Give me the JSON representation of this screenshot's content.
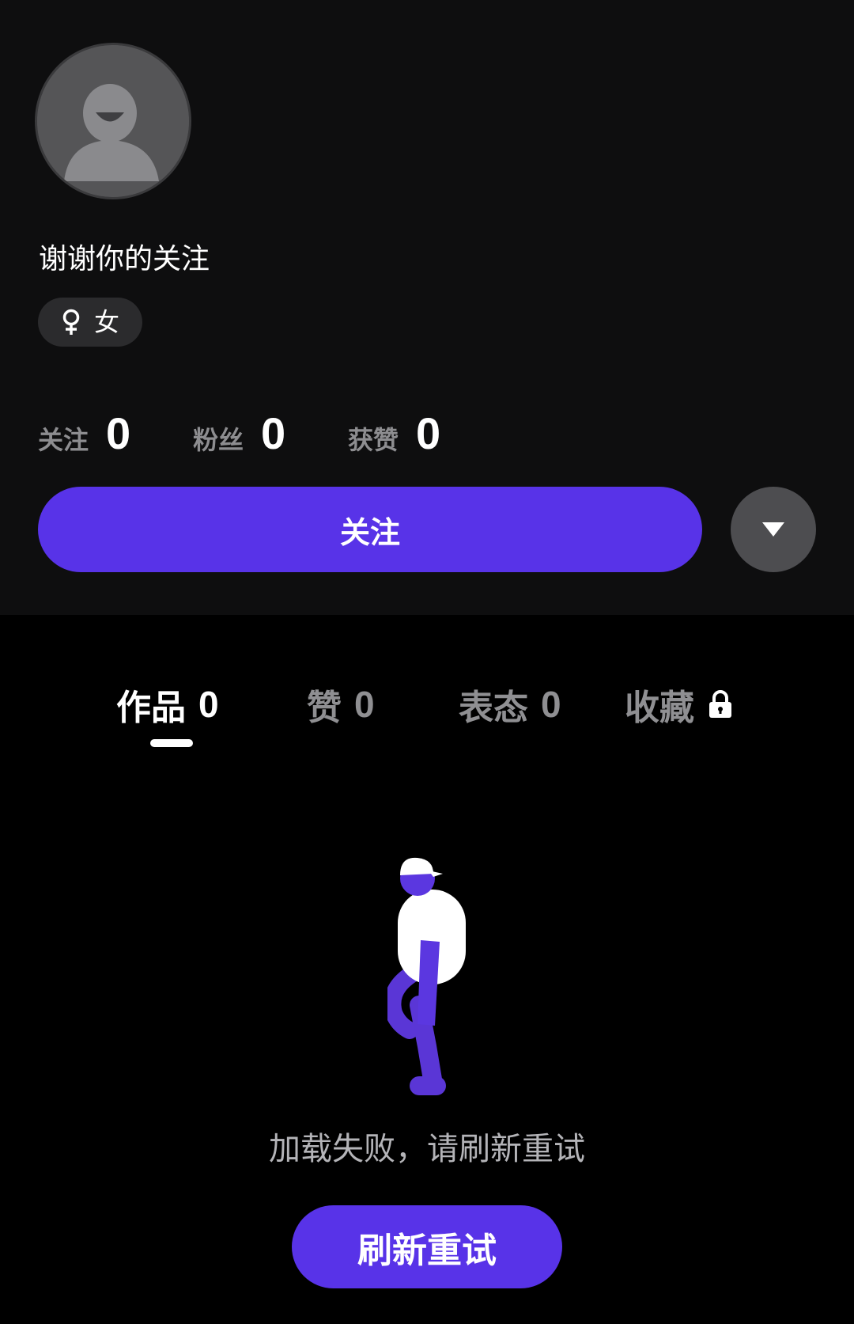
{
  "profile": {
    "avatar_icon": "default-avatar-icon",
    "nickname": "谢谢你的关注",
    "gender": {
      "icon": "female-symbol-icon",
      "label": "女"
    },
    "stats": [
      {
        "label": "关注",
        "value": "0"
      },
      {
        "label": "粉丝",
        "value": "0"
      },
      {
        "label": "获赞",
        "value": "0"
      }
    ],
    "follow_label": "关注",
    "more_icon": "triangle-down-icon"
  },
  "tabs": [
    {
      "label": "作品",
      "count": "0",
      "active": true
    },
    {
      "label": "赞",
      "count": "0",
      "active": false
    },
    {
      "label": "表态",
      "count": "0",
      "active": false
    },
    {
      "label": "收藏",
      "icon": "lock-icon",
      "active": false
    }
  ],
  "empty_state": {
    "illustration": "walking-person-illustration",
    "message": "加载失败，请刷新重试",
    "retry_label": "刷新重试"
  },
  "colors": {
    "accent": "#5833e8",
    "background": "#000000",
    "panel": "#0e0e0f",
    "muted_text": "#8f8f92"
  }
}
